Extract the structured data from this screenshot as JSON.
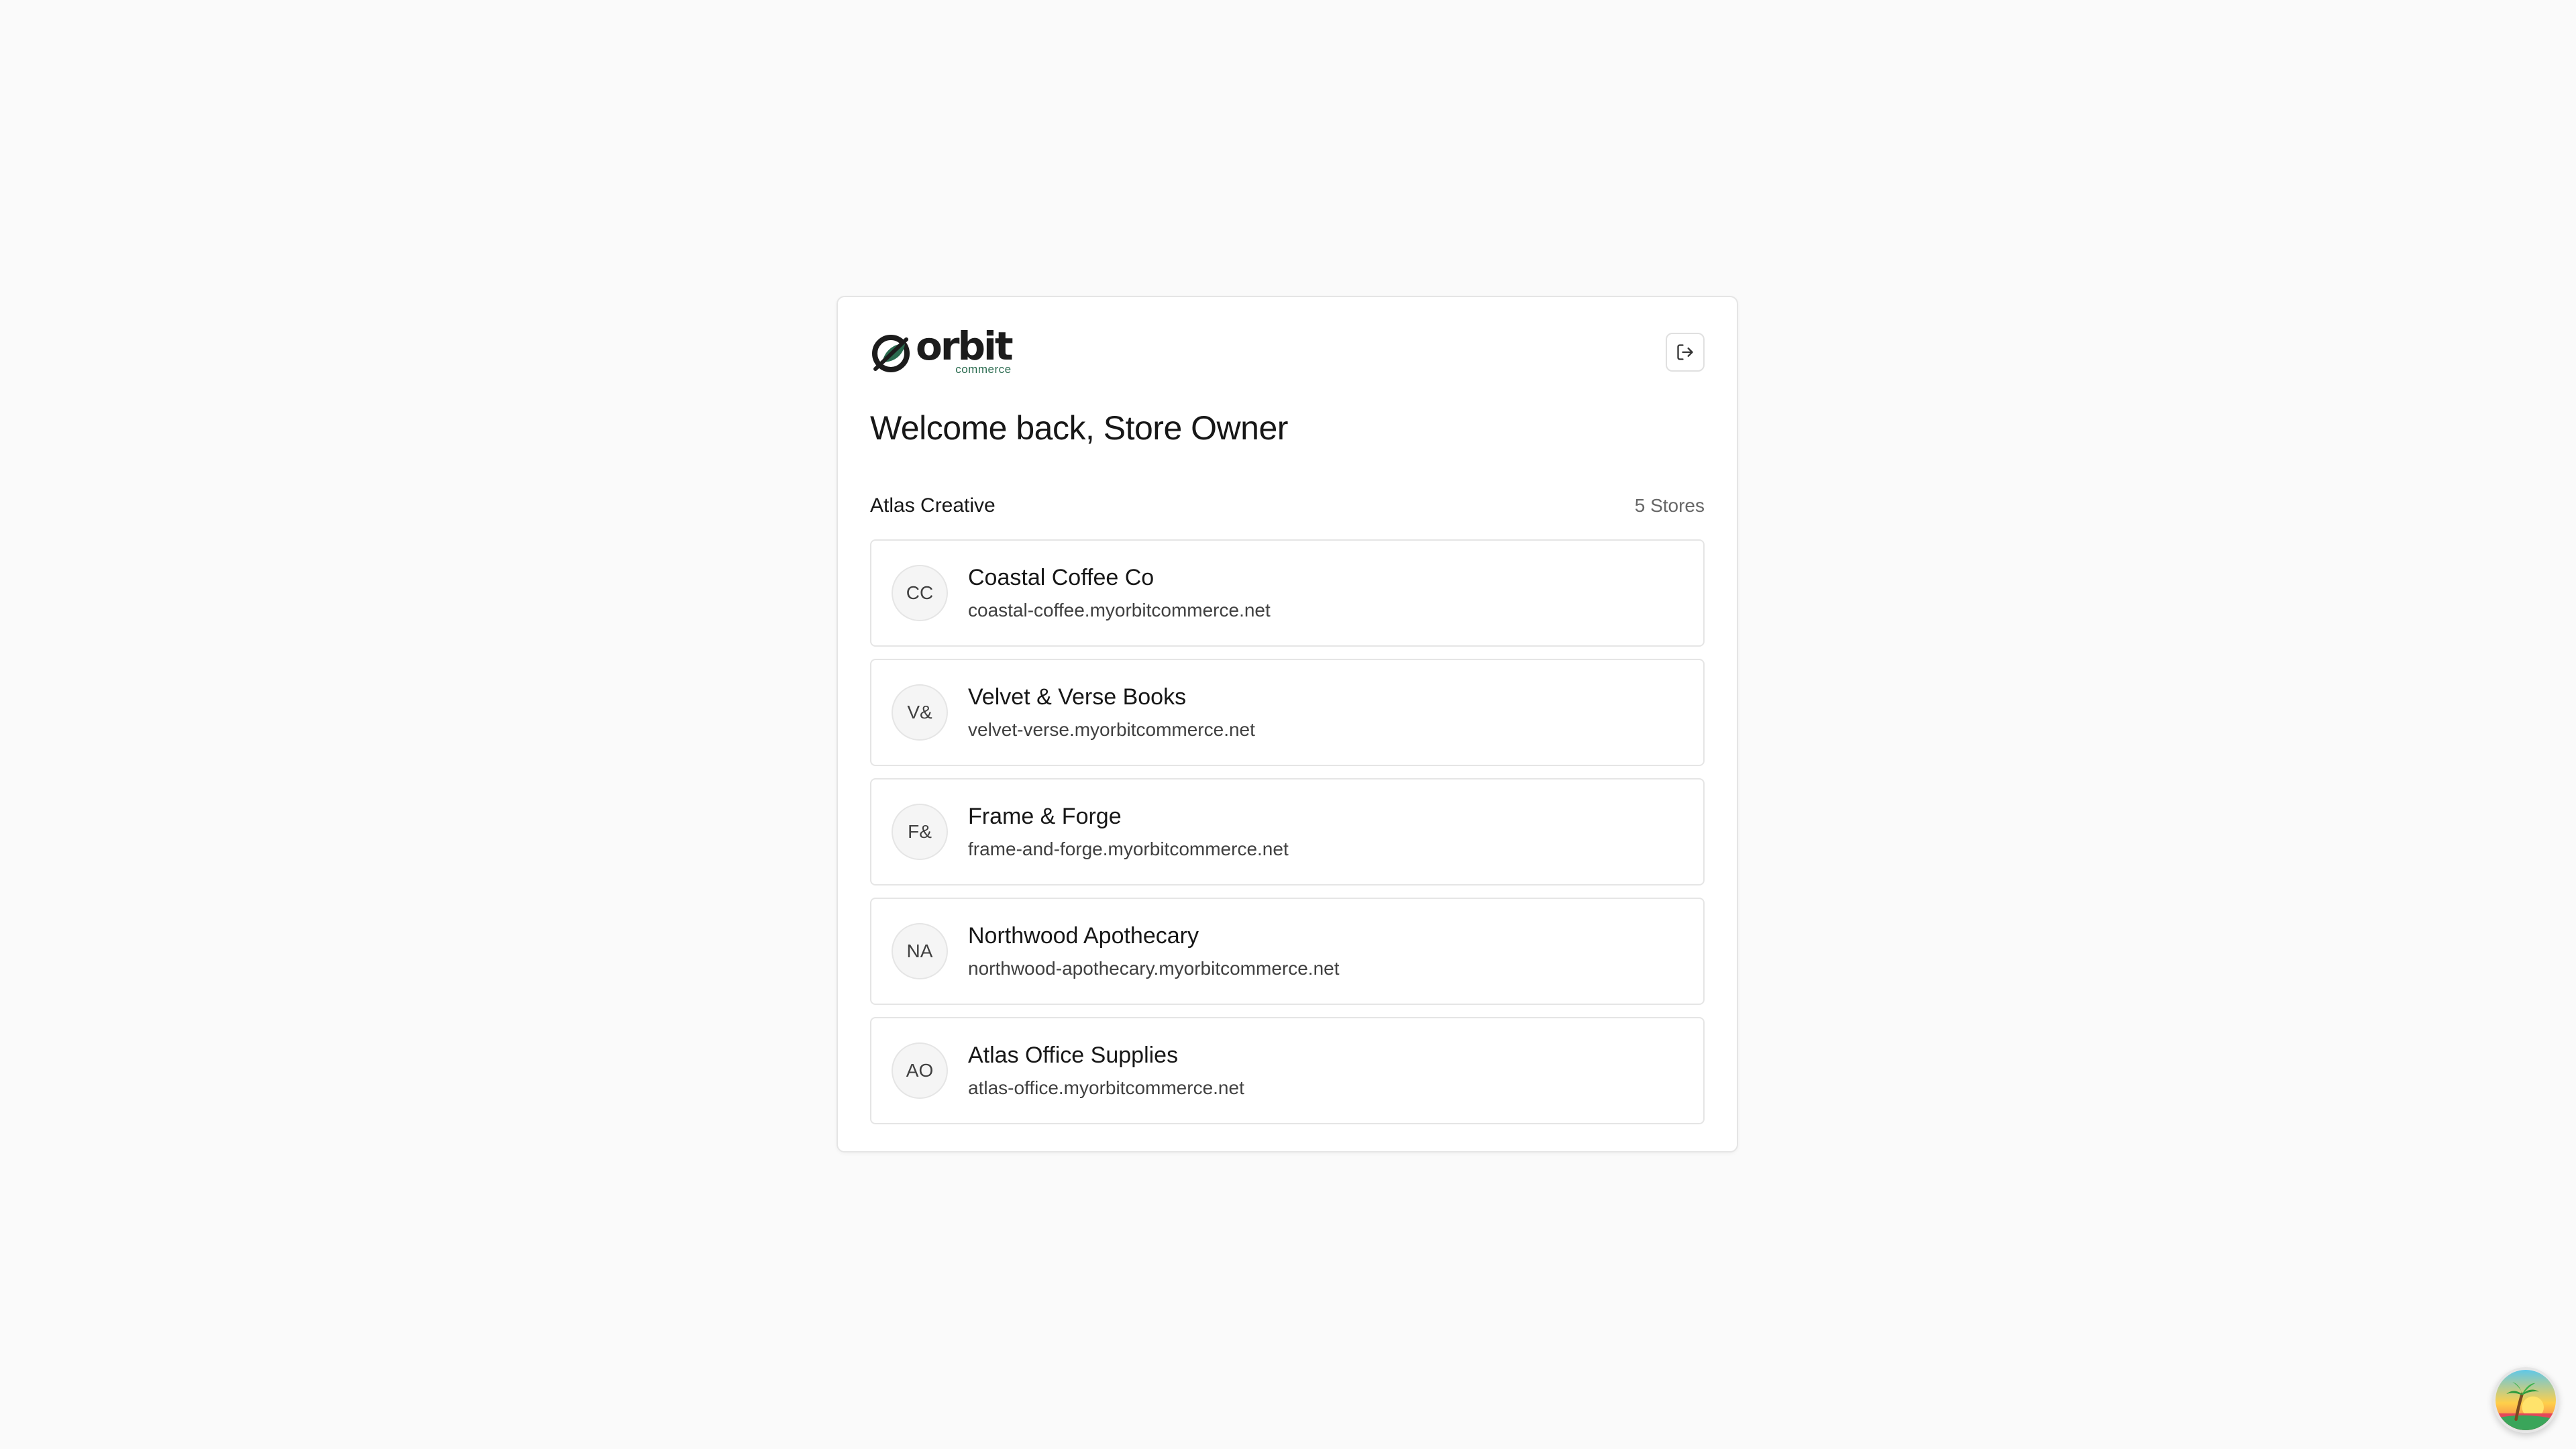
{
  "brand": {
    "wordmark": "orbit",
    "subword": "commerce",
    "colors": {
      "primary_dark": "#1c1c1c",
      "accent_green": "#2a6b4f"
    }
  },
  "header": {
    "logout_icon": "logout-icon"
  },
  "welcome": {
    "title": "Welcome back, Store Owner"
  },
  "organization": {
    "name": "Atlas Creative",
    "store_count": "5 Stores"
  },
  "stores": [
    {
      "initials": "CC",
      "name": "Coastal Coffee Co",
      "domain": "coastal-coffee.myorbitcommerce.net"
    },
    {
      "initials": "V&",
      "name": "Velvet & Verse Books",
      "domain": "velvet-verse.myorbitcommerce.net"
    },
    {
      "initials": "F&",
      "name": "Frame & Forge",
      "domain": "frame-and-forge.myorbitcommerce.net"
    },
    {
      "initials": "NA",
      "name": "Northwood Apothecary",
      "domain": "northwood-apothecary.myorbitcommerce.net"
    },
    {
      "initials": "AO",
      "name": "Atlas Office Supplies",
      "domain": "atlas-office.myorbitcommerce.net"
    }
  ],
  "assistant": {
    "icon": "palm-tree-sunset-icon"
  }
}
